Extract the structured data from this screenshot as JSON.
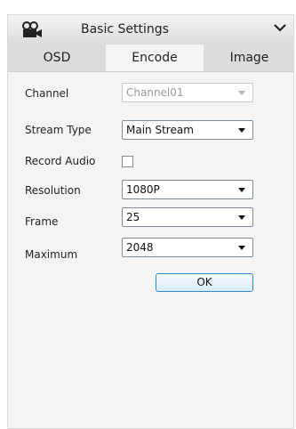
{
  "header": {
    "title": "Basic Settings",
    "icon": "camera-icon",
    "collapse_icon": "chevron-down-icon"
  },
  "tabs": [
    {
      "label": "OSD",
      "active": false
    },
    {
      "label": "Encode",
      "active": true
    },
    {
      "label": "Image",
      "active": false
    }
  ],
  "form": {
    "channel": {
      "label": "Channel",
      "value": "Channel01",
      "disabled": true
    },
    "stream_type": {
      "label": "Stream Type",
      "value": "Main Stream"
    },
    "record_audio": {
      "label": "Record Audio",
      "checked": false
    },
    "resolution": {
      "label": "Resolution",
      "value": "1080P"
    },
    "frame": {
      "label": "Frame",
      "value": "25"
    },
    "maximum": {
      "label": "Maximum",
      "value": "2048"
    }
  },
  "ok_label": "OK",
  "colors": {
    "accent_border": "#2e8ad0",
    "panel_bg": "#f4f4f4"
  }
}
